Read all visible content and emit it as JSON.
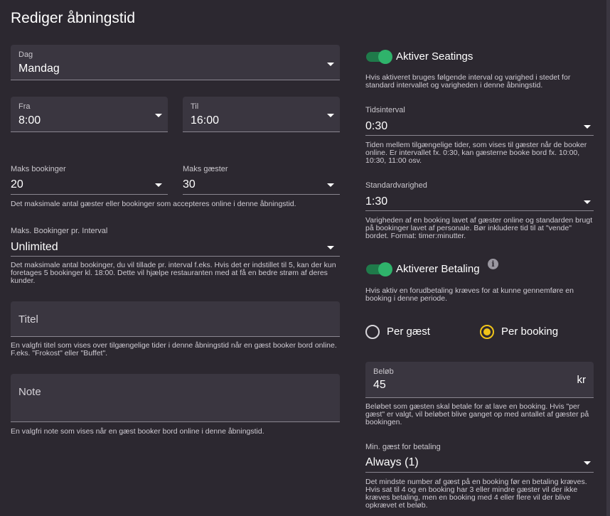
{
  "title": "Rediger åbningstid",
  "dag": {
    "label": "Dag",
    "value": "Mandag"
  },
  "fra": {
    "label": "Fra",
    "value": "8:00"
  },
  "til": {
    "label": "Til",
    "value": "16:00"
  },
  "maks_bookinger": {
    "label": "Maks bookinger",
    "value": "20"
  },
  "maks_gaester": {
    "label": "Maks gæster",
    "value": "30"
  },
  "maks_help": "Det maksimale antal gæster eller bookinger som accepteres online i denne åbningstid.",
  "interval_bookinger": {
    "label": "Maks. Bookinger pr. Interval",
    "value": "Unlimited",
    "help": "Det maksimale antal bookinger, du vil tillade pr. interval f.eks. Hvis det er indstillet til 5, kan der kun foretages 5 bookinger kl. 18:00. Dette vil hjælpe restauranten med at få en bedre strøm af deres kunder."
  },
  "titel": {
    "placeholder": "Titel",
    "help": "En valgfri titel som vises over tilgængelige tider i denne åbningstid når en gæst booker bord online. F.eks. \"Frokost\" eller \"Buffet\"."
  },
  "note": {
    "placeholder": "Note",
    "help": "En valgfri note som vises når en gæst booker bord online i denne åbningstid."
  },
  "seatings": {
    "label": "Aktiver Seatings",
    "enabled": true,
    "help": "Hvis aktiveret bruges følgende interval og varighed i stedet for standard intervallet og varigheden i denne åbningstid."
  },
  "tidsinterval": {
    "label": "Tidsinterval",
    "value": "0:30",
    "help": "Tiden mellem tilgængelige tider, som vises til gæster når de booker online. Er intervallet fx. 0:30, kan gæsterne booke bord fx. 10:00, 10:30, 11:00 osv."
  },
  "standardvarighed": {
    "label": "Standardvarighed",
    "value": "1:30",
    "help": "Varigheden af en booking lavet af gæster online og standarden brugt på bookinger lavet af personale. Bør inkludere tid til at \"vende\" bordet. Format: timer:minutter."
  },
  "betaling": {
    "label": "Aktiverer Betaling",
    "enabled": true,
    "info_icon": "info-icon",
    "help": "Hvis aktiv en forudbetaling kræves for at kunne gennemføre en booking i denne periode."
  },
  "radio": {
    "per_gaest": "Per gæst",
    "per_booking": "Per booking",
    "selected": "per_booking"
  },
  "beloeb": {
    "label": "Beløb",
    "value": "45",
    "suffix": "kr",
    "help": "Beløbet som gæsten skal betale for at lave en booking. Hvis \"per gæst\" er valgt, vil beløbet blive ganget op med antallet af gæster på bookingen."
  },
  "min_gaest": {
    "label": "Min. gæst for betaling",
    "value": "Always (1)",
    "help": "Det mindste number af gæst på en booking før en betaling kræves. Hvis sat til 4 og en booking har 3 eller mindre gæster vil der ikke kræves betaling, men en booking med 4 eller flere vil der blive opkrævet et beløb."
  },
  "colors": {
    "background": "#2c2830",
    "field": "#3a3640",
    "toggle_on": "#2fb36b",
    "radio_selected": "#f0c419"
  }
}
